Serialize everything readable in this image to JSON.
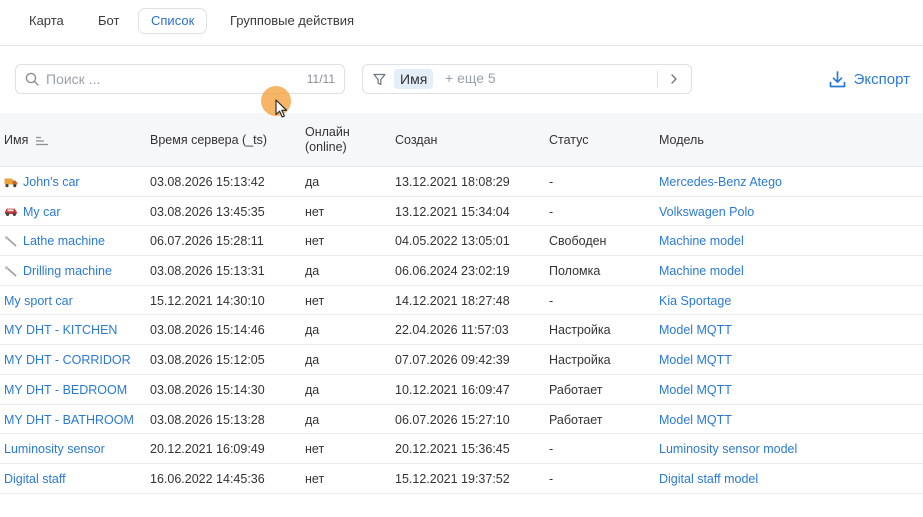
{
  "tabs": [
    {
      "label": "Карта",
      "icon": "none",
      "active": false
    },
    {
      "label": "Бот",
      "active": false
    },
    {
      "label": "Список",
      "active": true
    },
    {
      "label": "Групповые действия",
      "active": false
    }
  ],
  "search": {
    "placeholder": "Поиск ...",
    "value": "",
    "count": "11/11"
  },
  "filter": {
    "chip": "Имя",
    "more": "+ еще 5"
  },
  "export": {
    "label": "Экспорт"
  },
  "colors": {
    "accent": "#2a7ad5",
    "cursor": "#f5a03c"
  },
  "table": {
    "headers": {
      "name": "Имя",
      "server_time": "Время сервера (_ts)",
      "online_line1": "Онлайн",
      "online_line2": "(online)",
      "created": "Создан",
      "status": "Статус",
      "model": "Модель"
    },
    "rows": [
      {
        "icon": "truck-icon",
        "name": "John's car",
        "server_time": "03.08.2026 15:13:42",
        "online": "да",
        "created": "13.12.2021 18:08:29",
        "status": "-",
        "model": "Mercedes-Benz Atego"
      },
      {
        "icon": "car-icon",
        "name": "My car",
        "server_time": "03.08.2026 13:45:35",
        "online": "нет",
        "created": "13.12.2021 15:34:04",
        "status": "-",
        "model": "Volkswagen Polo"
      },
      {
        "icon": "tool-icon",
        "name": "Lathe machine",
        "server_time": "06.07.2026 15:28:11",
        "online": "нет",
        "created": "04.05.2022 13:05:01",
        "status": "Свободен",
        "model": "Machine model"
      },
      {
        "icon": "tool-icon",
        "name": "Drilling machine",
        "server_time": "03.08.2026 15:13:31",
        "online": "да",
        "created": "06.06.2024 23:02:19",
        "status": "Поломка",
        "model": "Machine model"
      },
      {
        "icon": "",
        "name": "My sport car",
        "server_time": "15.12.2021 14:30:10",
        "online": "нет",
        "created": "14.12.2021 18:27:48",
        "status": "-",
        "model": "Kia Sportage"
      },
      {
        "icon": "",
        "name": "MY DHT - KITCHEN",
        "server_time": "03.08.2026 15:14:46",
        "online": "да",
        "created": "22.04.2026 11:57:03",
        "status": "Настройка",
        "model": "Model MQTT"
      },
      {
        "icon": "",
        "name": "MY DHT - CORRIDOR",
        "server_time": "03.08.2026 15:12:05",
        "online": "да",
        "created": "07.07.2026 09:42:39",
        "status": "Настройка",
        "model": "Model MQTT"
      },
      {
        "icon": "",
        "name": "MY DHT - BEDROOM",
        "server_time": "03.08.2026 15:14:30",
        "online": "да",
        "created": "10.12.2021 16:09:47",
        "status": "Работает",
        "model": "Model MQTT"
      },
      {
        "icon": "",
        "name": "MY DHT - BATHROOM",
        "server_time": "03.08.2026 15:13:28",
        "online": "да",
        "created": "06.07.2026 15:27:10",
        "status": "Работает",
        "model": "Model MQTT"
      },
      {
        "icon": "",
        "name": "Luminosity sensor",
        "server_time": "20.12.2021 16:09:49",
        "online": "нет",
        "created": "20.12.2021 15:36:45",
        "status": "-",
        "model": "Luminosity sensor model"
      },
      {
        "icon": "",
        "name": "Digital staff",
        "server_time": "16.06.2022 14:45:36",
        "online": "нет",
        "created": "15.12.2021 19:37:52",
        "status": "-",
        "model": "Digital staff model"
      }
    ]
  }
}
